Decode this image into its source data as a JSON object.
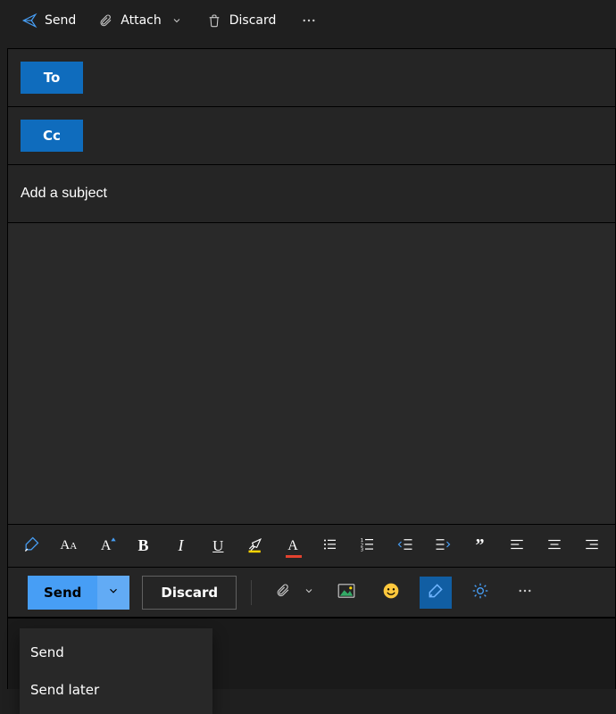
{
  "top_toolbar": {
    "send": "Send",
    "attach": "Attach",
    "discard": "Discard"
  },
  "addr": {
    "to": "To",
    "cc": "Cc"
  },
  "subject": {
    "placeholder": "Add a subject",
    "value": ""
  },
  "action_bar": {
    "send": "Send",
    "discard": "Discard"
  },
  "send_menu": {
    "send": "Send",
    "send_later": "Send later"
  }
}
